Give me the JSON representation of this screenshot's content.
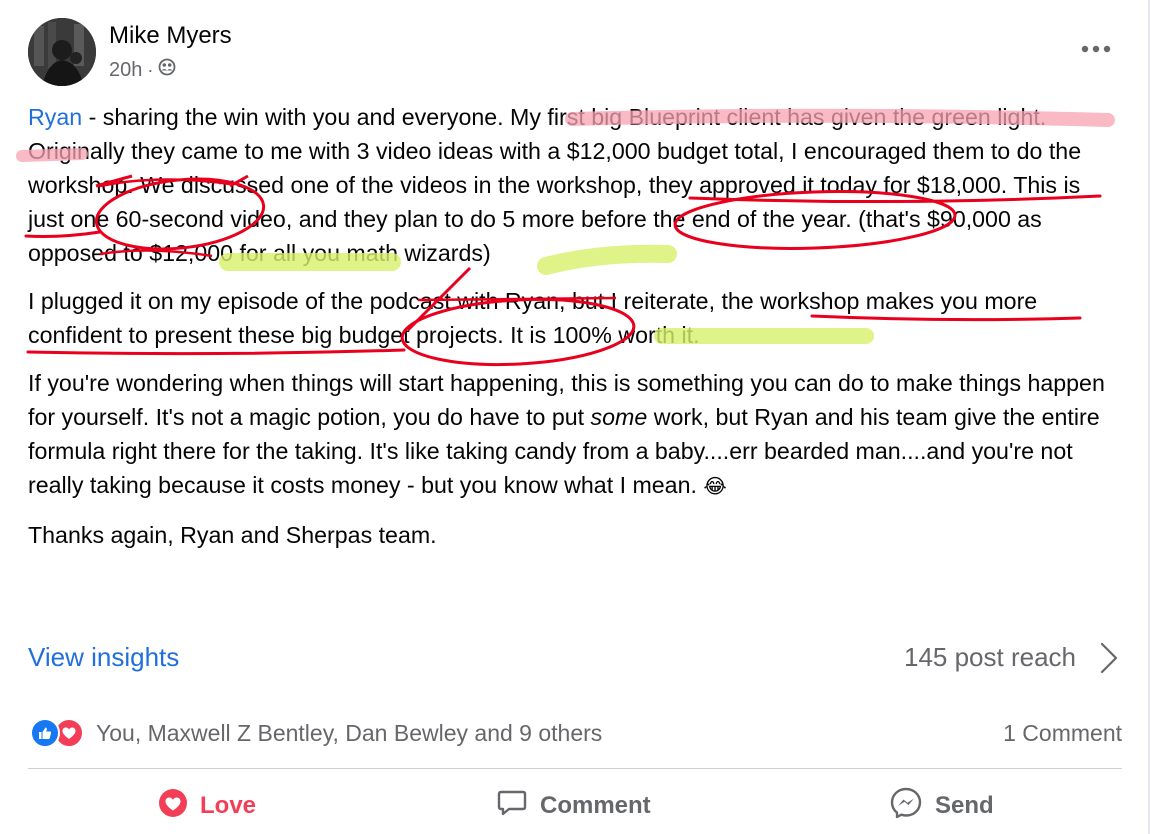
{
  "post": {
    "author": "Mike Myers",
    "time": "20h",
    "time_separator": "·",
    "audience_icon": "friends-icon",
    "paragraphs": {
      "p1": {
        "mention": "Ryan",
        "text": " - sharing the win with you and everyone. My first big Blueprint client has given the green light. Originally they came to me with 3 video ideas with a $12,000 budget total, I encouraged them to do the workshop. We discussed one of the videos in the workshop, they approved it today for $18,000. This is just one 60-second video, and they plan to do 5 more before the end of the year. (that's $90,000 as opposed to $12,000 for all you math wizards)"
      },
      "p2": "I plugged it on my episode of the podcast with Ryan, but I reiterate, the workshop makes you more confident to present these big budget projects. It is 100% worth it.",
      "p3": {
        "before": "If you're wondering when things will start happening, this is something you can do to make things happen for yourself. It's not a magic potion, you do have to put ",
        "emphasis": "some",
        "after": " work, but Ryan and his team give the entire formula right there for the taking. It's like taking candy from a baby....err bearded man....and you're not really taking because it costs money - but you know what I mean. ",
        "emoji": "😂"
      },
      "p4": "Thanks again, Ryan and Sherpas team."
    }
  },
  "insights": {
    "link": "View insights",
    "reach": "145 post reach"
  },
  "reactions": {
    "icons": [
      "like-icon",
      "love-icon"
    ],
    "names": "You, Maxwell Z Bentley, Dan Bewley and 9 others",
    "comments": "1 Comment"
  },
  "actions": {
    "love": "Love",
    "comment": "Comment",
    "send": "Send"
  },
  "colors": {
    "link_blue": "#216fdb",
    "love_red": "#f33e58",
    "secondary_text": "#65676b",
    "annotation_red": "#e8001c",
    "annotation_pink": "#f7a3b1",
    "annotation_green": "#d8f06a"
  }
}
